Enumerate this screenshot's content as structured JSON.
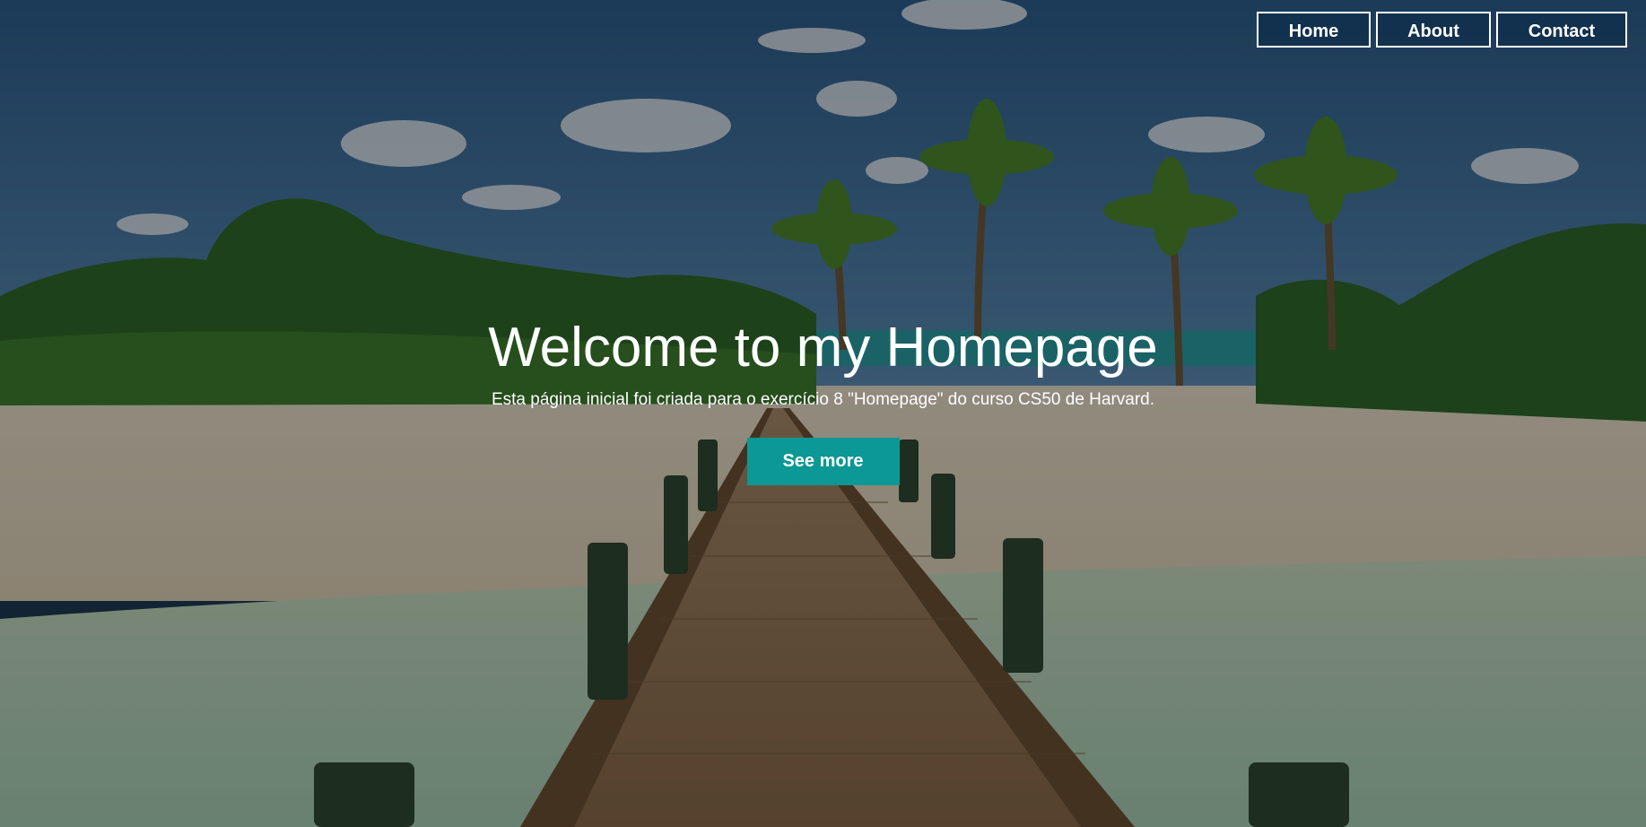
{
  "nav": {
    "items": [
      {
        "label": "Home"
      },
      {
        "label": "About"
      },
      {
        "label": "Contact"
      }
    ]
  },
  "hero": {
    "title": "Welcome to my Homepage",
    "subtitle": "Esta página inicial foi criada para o exercício 8 \"Homepage\" do curso CS50 de Harvard.",
    "cta_label": "See more"
  },
  "colors": {
    "accent": "#0c9894",
    "nav_border": "#ffffff",
    "text": "#ffffff"
  }
}
